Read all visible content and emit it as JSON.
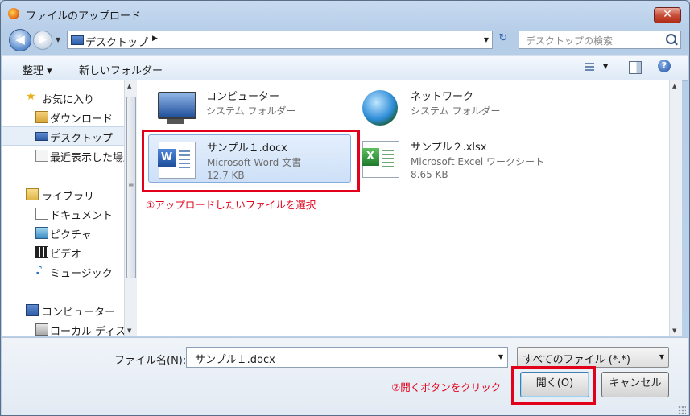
{
  "window": {
    "title": "ファイルのアップロード",
    "close_glyph": "✕"
  },
  "nav": {
    "back_glyph": "◀",
    "forward_glyph": "▶",
    "history_glyph": "▼",
    "address": {
      "location": "デスクトップ",
      "separator": "▶",
      "dropdown_glyph": "▼"
    },
    "refresh_glyph": "↻",
    "search_placeholder": "デスクトップの検索"
  },
  "toolbar": {
    "organize": "整理 ▾",
    "new_folder": "新しいフォルダー",
    "help_glyph": "?"
  },
  "sidebar": {
    "favorites": [
      {
        "label": "お気に入り",
        "icon": "star-icon"
      },
      {
        "label": "ダウンロード",
        "icon": "downloads-folder-icon"
      },
      {
        "label": "デスクトップ",
        "icon": "desktop-icon",
        "selected": true
      },
      {
        "label": "最近表示した場所",
        "icon": "recent-places-icon"
      }
    ],
    "libraries": [
      {
        "label": "ライブラリ",
        "icon": "library-icon"
      },
      {
        "label": "ドキュメント",
        "icon": "documents-icon"
      },
      {
        "label": "ピクチャ",
        "icon": "pictures-icon"
      },
      {
        "label": "ビデオ",
        "icon": "videos-icon"
      },
      {
        "label": "ミュージック",
        "icon": "music-icon"
      }
    ],
    "computer": [
      {
        "label": "コンピューター",
        "icon": "computer-icon"
      },
      {
        "label": "ローカル ディスク",
        "icon": "local-disk-icon"
      }
    ],
    "scroll_up": "▲",
    "scroll_down": "▼"
  },
  "files": [
    {
      "name": "コンピューター",
      "type": "システム フォルダー",
      "size": "",
      "icon": "computer-icon"
    },
    {
      "name": "ネットワーク",
      "type": "システム フォルダー",
      "size": "",
      "icon": "network-icon"
    },
    {
      "name": "サンプル１.docx",
      "type": "Microsoft Word 文書",
      "size": "12.7 KB",
      "icon": "word-document-icon",
      "selected": true
    },
    {
      "name": "サンプル２.xlsx",
      "type": "Microsoft Excel ワークシート",
      "size": "8.65 KB",
      "icon": "excel-workbook-icon"
    }
  ],
  "annotations": {
    "step1": "①アップロードしたいファイルを選択",
    "step2": "②開くボタンをクリック",
    "color": "#e3001b"
  },
  "bottom": {
    "filename_label": "ファイル名(N):",
    "filename_value": "サンプル１.docx",
    "filter_value": "すべてのファイル (*.*)",
    "open_label": "開く(O)",
    "cancel_label": "キャンセル",
    "dropdown_glyph": "▼"
  }
}
